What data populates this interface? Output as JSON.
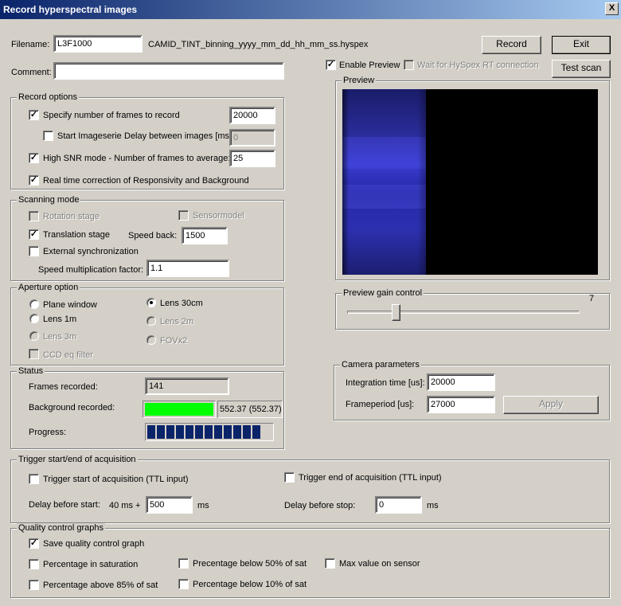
{
  "window": {
    "title": "Record hyperspectral images",
    "close": "X"
  },
  "file": {
    "filename_label": "Filename:",
    "filename_value": "L3F1000",
    "filename_pattern": "CAMID_TINT_binning_yyyy_mm_dd_hh_mm_ss.hyspex",
    "comment_label": "Comment:",
    "comment_value": ""
  },
  "buttons": {
    "record": "Record",
    "exit": "Exit",
    "test_scan": "Test scan",
    "apply": "Apply"
  },
  "preview_opts": {
    "enable_preview": "Enable Preview",
    "wait_rt": "Wait for HySpex RT connection"
  },
  "record_options": {
    "legend": "Record options",
    "specify_frames": "Specify number of frames to record",
    "frames_value": "20000",
    "start_imageserie": "Start Imageserie",
    "delay_label": "Delay between images [ms]:",
    "delay_value": "0",
    "high_snr": "High SNR mode - Number of frames to average:",
    "snr_value": "25",
    "realtime_correction": "Real time correction of Responsivity and Background"
  },
  "scanning": {
    "legend": "Scanning  mode",
    "rotation_stage": "Rotation stage",
    "sensormodel": "Sensormodel",
    "translation_stage": "Translation stage",
    "speed_back_label": "Speed back:",
    "speed_back_value": "1500",
    "external_sync": "External synchronization",
    "speed_mult_label": "Speed multiplication factor:",
    "speed_mult_value": "1.1"
  },
  "aperture": {
    "legend": "Aperture option",
    "plane_window": "Plane window",
    "lens_30cm": "Lens 30cm",
    "lens_1m": "Lens 1m",
    "lens_2m": "Lens 2m",
    "lens_3m": "Lens 3m",
    "fovx2": "FOVx2",
    "ccd_eq": "CCD eq filter"
  },
  "status": {
    "legend": "Status",
    "frames_recorded_label": "Frames recorded:",
    "frames_recorded_value": "141",
    "background_label": "Background recorded:",
    "background_value": "552.37 (552.37)",
    "progress_label": "Progress:",
    "progress_fraction": 0.96,
    "progress_color": "#0a246a",
    "background_color": "#00ff00"
  },
  "preview": {
    "legend": "Preview"
  },
  "gain": {
    "legend": "Preview gain control",
    "value": "7",
    "slider_fraction": 0.2
  },
  "camera": {
    "legend": "Camera parameters",
    "integration_label": "Integration time [us]:",
    "integration_value": "20000",
    "frameperiod_label": "Frameperiod [us]:",
    "frameperiod_value": "27000"
  },
  "trigger": {
    "legend": "Trigger start/end of acquisition",
    "start_label": "Trigger start of acquisition  (TTL input)",
    "end_label": "Trigger end of acquisition (TTL input)",
    "delay_start_label": "Delay before start:",
    "delay_start_prefix": "40 ms +",
    "delay_start_value": "500",
    "ms1": "ms",
    "delay_stop_label": "Delay before stop:",
    "delay_stop_value": "0",
    "ms2": "ms"
  },
  "quality": {
    "legend": "Quality control graphs",
    "save_graph": "Save quality control graph",
    "pct_saturation": "Percentage in saturation",
    "pct_below_50": "Precentage below 50% of sat",
    "max_value": "Max value on sensor",
    "pct_above_85": "Percentage above 85% of sat",
    "pct_below_10": "Percentage below 10% of sat"
  }
}
